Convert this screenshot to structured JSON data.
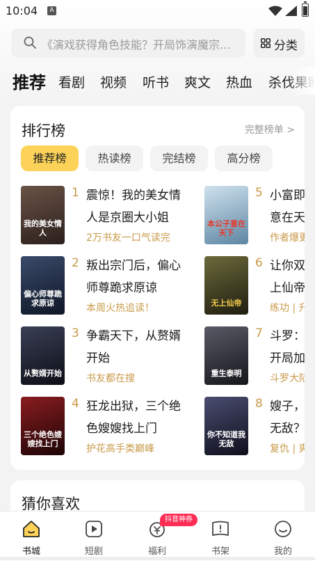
{
  "status": {
    "time": "10:04",
    "indicator": "A"
  },
  "search": {
    "placeholder": "《演戏获得角色技能？开局饰演魔宗…",
    "category_label": "分类"
  },
  "tabs": [
    {
      "label": "推荐",
      "active": true
    },
    {
      "label": "看剧"
    },
    {
      "label": "视频"
    },
    {
      "label": "听书"
    },
    {
      "label": "爽文"
    },
    {
      "label": "热血"
    },
    {
      "label": "杀伐果断"
    }
  ],
  "ranking": {
    "title": "排行榜",
    "full_list": "完整榜单 >",
    "filters": [
      {
        "label": "推荐榜",
        "active": true
      },
      {
        "label": "热读榜"
      },
      {
        "label": "完结榜"
      },
      {
        "label": "高分榜"
      }
    ],
    "books": [
      {
        "rank": "1",
        "title": "震惊！我的美女情人是京圈大小姐",
        "tag": "2万书友一口气读完",
        "cover_text": "我的美女情人",
        "cover_color": "#4a3a35"
      },
      {
        "rank": "2",
        "title": "叛出宗门后，偏心师尊跪求原谅",
        "tag": "本周火热追读！",
        "cover_text": "偏心师尊跪求原谅",
        "cover_color": "#1e2a40"
      },
      {
        "rank": "3",
        "title": "争霸天下，从赘婿开始",
        "tag": "书友都在搜",
        "cover_text": "从赘婿开始",
        "cover_color": "#1a1e2a"
      },
      {
        "rank": "4",
        "title": "狂龙出狱，三个绝色嫂嫂找上门",
        "tag": "护花高手类巅峰",
        "cover_text": "三个绝色嫂嫂找上门",
        "cover_color": "#3a0d10"
      },
      {
        "rank": "5",
        "title": "小富即安，本公子意在天下",
        "tag": "作者爆更",
        "cover_text": "本公子意在天下",
        "cover_color": "#8fb3c9"
      },
      {
        "rank": "6",
        "title": "让你双修，你成无上仙帝",
        "tag": "练功 | 升级",
        "cover_text": "无上仙帝",
        "cover_color": "#3b3a22"
      },
      {
        "rank": "7",
        "title": "斗罗：重生泰明，开局加入武魂殿",
        "tag": "斗罗大陆",
        "cover_text": "重生泰明",
        "cover_color": "#2a2a33"
      },
      {
        "rank": "8",
        "title": "嫂子，你不知道我无敌？",
        "tag": "复仇 | 爽文",
        "cover_text": "你不知道我无敌",
        "cover_color": "#22243a"
      }
    ]
  },
  "guess": {
    "title": "猜你喜欢"
  },
  "nav": {
    "items": [
      {
        "label": "书城",
        "icon": "home-icon",
        "active": true
      },
      {
        "label": "短剧",
        "icon": "play-icon"
      },
      {
        "label": "福利",
        "icon": "gift-icon"
      },
      {
        "label": "书架",
        "icon": "bookshelf-icon"
      },
      {
        "label": "我的",
        "icon": "profile-icon"
      }
    ],
    "badge": "抖音神券"
  },
  "colors": {
    "accent": "#fcd258",
    "tag": "#c99a4a",
    "badge": "#ff2d55"
  }
}
